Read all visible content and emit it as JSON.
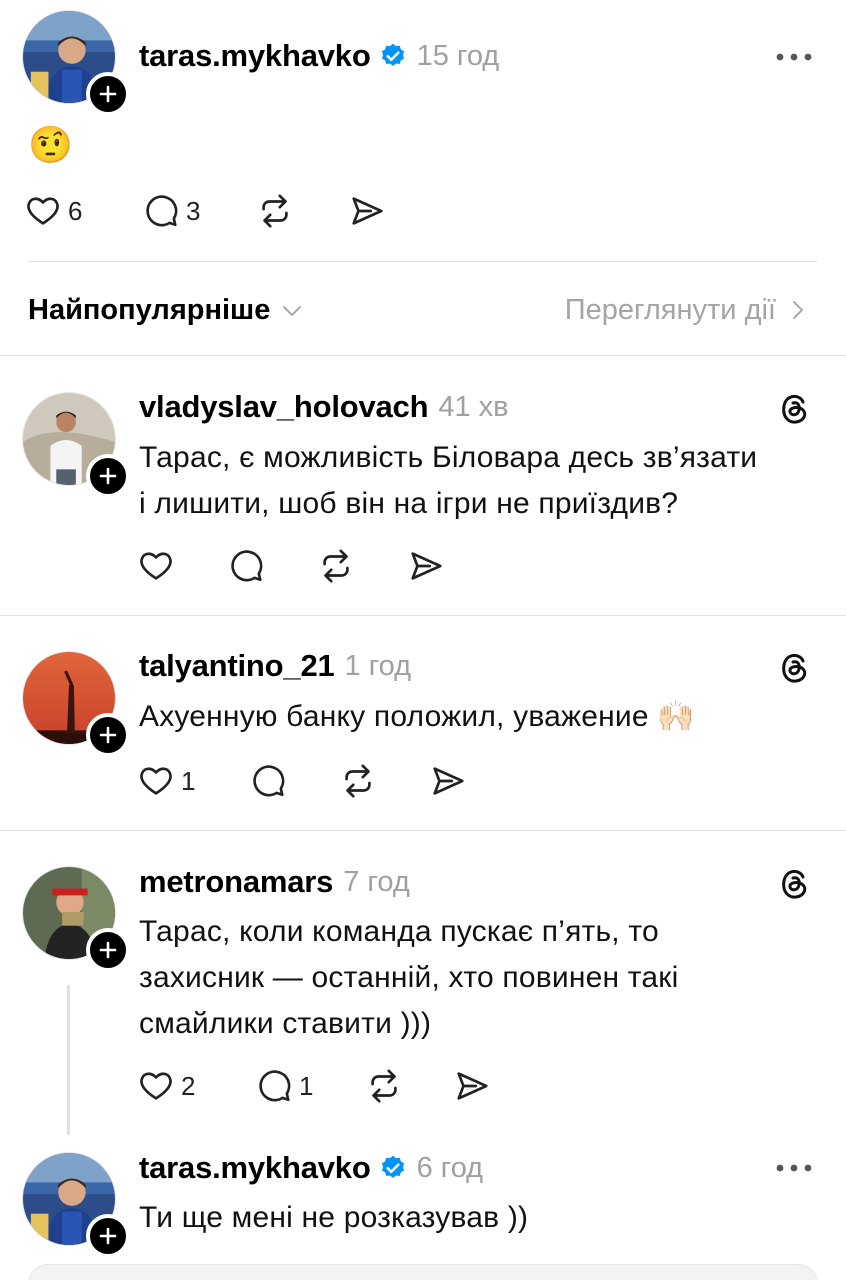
{
  "post": {
    "username": "taras.mykhavko",
    "time": "15 год",
    "text": "🤨",
    "likes": "6",
    "replies": "3"
  },
  "sort": {
    "label": "Найпопулярніше",
    "activity": "Переглянути дії"
  },
  "comments": [
    {
      "username": "vladyslav_holovach",
      "time": "41 хв",
      "lines": [
        "Тарас, є можливість Біловара десь зв’язати",
        "і лишити, шоб він на ігри не приїздив?"
      ],
      "likes": "",
      "replies": ""
    },
    {
      "username": "talyantino_21",
      "time": "1 год",
      "lines": [
        "Ахуенную банку положил, уважение 🙌🏻"
      ],
      "likes": "1",
      "replies": ""
    },
    {
      "username": "metronamars",
      "time": "7 год",
      "lines": [
        "Тарас, коли команда пускає п’ять, то",
        "захисник — останній, хто повинен такі",
        "смайлики ставити )))"
      ],
      "likes": "2",
      "replies": "1"
    }
  ],
  "reply": {
    "username": "taras.mykhavko",
    "time": "6 год",
    "text": "Ти ще мені не розказував ))"
  },
  "colors": {
    "verified": "#0095f6",
    "muted": "#a0a0a0",
    "divider": "#e3e3e3"
  }
}
